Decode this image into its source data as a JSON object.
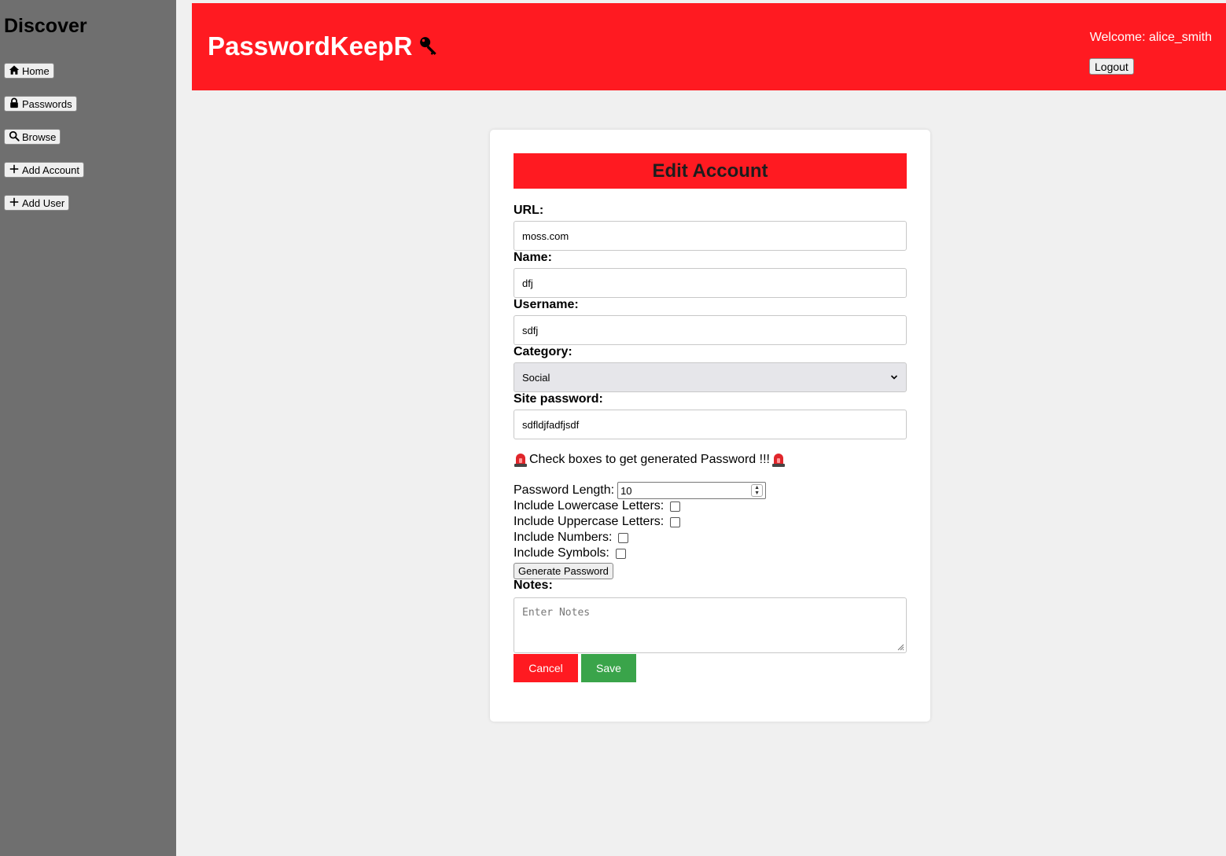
{
  "sidebar": {
    "title": "Discover",
    "items": [
      {
        "label": "Home",
        "icon": "home-icon"
      },
      {
        "label": "Passwords",
        "icon": "lock-icon"
      },
      {
        "label": "Browse",
        "icon": "search-icon"
      },
      {
        "label": "Add Account",
        "icon": "plus-icon"
      },
      {
        "label": "Add User",
        "icon": "plus-icon"
      }
    ]
  },
  "header": {
    "brand": "PasswordKeepR",
    "brand_icon": "key-icon",
    "welcome": "Welcome: alice_smith",
    "logout_label": "Logout"
  },
  "form": {
    "title": "Edit Account",
    "url_label": "URL:",
    "url_value": "moss.com",
    "name_label": "Name:",
    "name_value": "dfj",
    "username_label": "Username:",
    "username_value": "sdfj",
    "category_label": "Category:",
    "category_value": "Social",
    "password_label": "Site password:",
    "password_value": "sdfldjfadfjsdf",
    "notice": "Check boxes to get generated Password !!!",
    "length_label": "Password Length:",
    "length_value": "10",
    "lowercase_label": "Include Lowercase Letters:",
    "uppercase_label": "Include Uppercase Letters:",
    "numbers_label": "Include Numbers:",
    "symbols_label": "Include Symbols:",
    "generate_label": "Generate Password",
    "notes_label": "Notes:",
    "notes_placeholder": "Enter Notes",
    "cancel_label": "Cancel",
    "save_label": "Save"
  },
  "colors": {
    "brand_red": "#ff1a21",
    "sidebar_gray": "#6f6f6f",
    "save_green": "#3aa44a"
  }
}
